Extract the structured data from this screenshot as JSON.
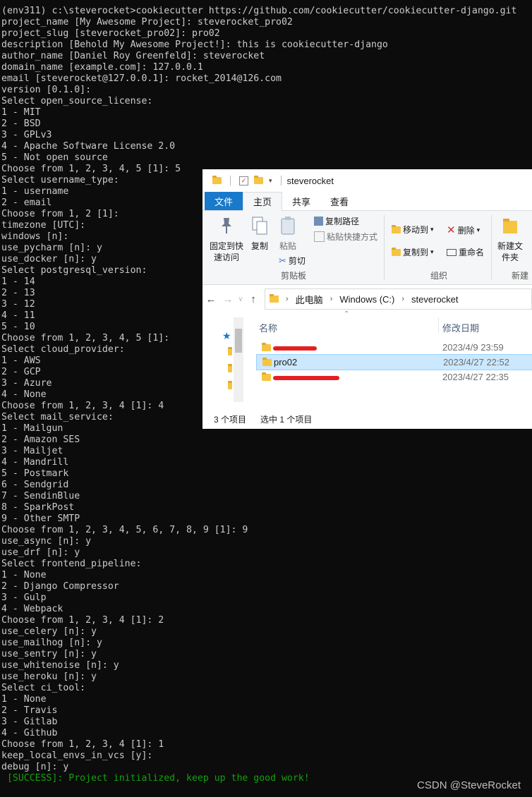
{
  "terminal": {
    "lines": [
      "(env311) c:\\steverocket>cookiecutter https://github.com/cookiecutter/cookiecutter-django.git",
      "project_name [My Awesome Project]: steverocket_pro02",
      "project_slug [steverocket_pro02]: pro02",
      "description [Behold My Awesome Project!]: this is cookiecutter-django",
      "author_name [Daniel Roy Greenfeld]: steverocket",
      "domain_name [example.com]: 127.0.0.1",
      "email [steverocket@127.0.0.1]: rocket_2014@126.com",
      "version [0.1.0]:",
      "Select open_source_license:",
      "1 - MIT",
      "2 - BSD",
      "3 - GPLv3",
      "4 - Apache Software License 2.0",
      "5 - Not open source",
      "Choose from 1, 2, 3, 4, 5 [1]: 5",
      "Select username_type:",
      "1 - username",
      "2 - email",
      "Choose from 1, 2 [1]:",
      "timezone [UTC]:",
      "windows [n]:",
      "use_pycharm [n]: y",
      "use_docker [n]: y",
      "Select postgresql_version:",
      "1 - 14",
      "2 - 13",
      "3 - 12",
      "4 - 11",
      "5 - 10",
      "Choose from 1, 2, 3, 4, 5 [1]:",
      "Select cloud_provider:",
      "1 - AWS",
      "2 - GCP",
      "3 - Azure",
      "4 - None",
      "Choose from 1, 2, 3, 4 [1]: 4",
      "Select mail_service:",
      "1 - Mailgun",
      "2 - Amazon SES",
      "3 - Mailjet",
      "4 - Mandrill",
      "5 - Postmark",
      "6 - Sendgrid",
      "7 - SendinBlue",
      "8 - SparkPost",
      "9 - Other SMTP",
      "Choose from 1, 2, 3, 4, 5, 6, 7, 8, 9 [1]: 9",
      "use_async [n]: y",
      "use_drf [n]: y",
      "Select frontend_pipeline:",
      "1 - None",
      "2 - Django Compressor",
      "3 - Gulp",
      "4 - Webpack",
      "Choose from 1, 2, 3, 4 [1]: 2",
      "use_celery [n]: y",
      "use_mailhog [n]: y",
      "use_sentry [n]: y",
      "use_whitenoise [n]: y",
      "use_heroku [n]: y",
      "Select ci_tool:",
      "1 - None",
      "2 - Travis",
      "3 - Gitlab",
      "4 - Github",
      "Choose from 1, 2, 3, 4 [1]: 1",
      "keep_local_envs_in_vcs [y]:",
      "debug [n]: y"
    ],
    "success_line": " [SUCCESS]: Project initialized, keep up the good work!",
    "success_color": "#13a10e"
  },
  "explorer": {
    "title": "steverocket",
    "tabs": {
      "file": "文件",
      "home": "主页",
      "share": "共享",
      "view": "查看"
    },
    "ribbon": {
      "pin_quick_access": "固定到快速访问",
      "copy": "复制",
      "paste": "粘贴",
      "copy_path": "复制路径",
      "paste_shortcut": "粘贴快捷方式",
      "cut": "剪切",
      "clipboard_group": "剪贴板",
      "move_to": "移动到",
      "copy_to": "复制到",
      "delete": "删除",
      "rename": "重命名",
      "organize_group": "组织",
      "new_folder": "新建文件夹",
      "new_group": "新建"
    },
    "breadcrumb": {
      "this_pc": "此电脑",
      "drive": "Windows (C:)",
      "folder": "steverocket"
    },
    "columns": {
      "name": "名称",
      "modified": "修改日期"
    },
    "files": [
      {
        "name": "",
        "date": "2023/4/9 23:59",
        "redacted": true
      },
      {
        "name": "pro02",
        "date": "2023/4/27 22:52",
        "redacted": false
      },
      {
        "name": "",
        "date": "2023/4/27 22:35",
        "redacted": true
      }
    ],
    "status": {
      "count": "3 个项目",
      "selected": "选中 1 个项目"
    },
    "accent_color": "#1979ca",
    "selection_color": "#cce8ff"
  },
  "watermark": "CSDN @SteveRocket"
}
